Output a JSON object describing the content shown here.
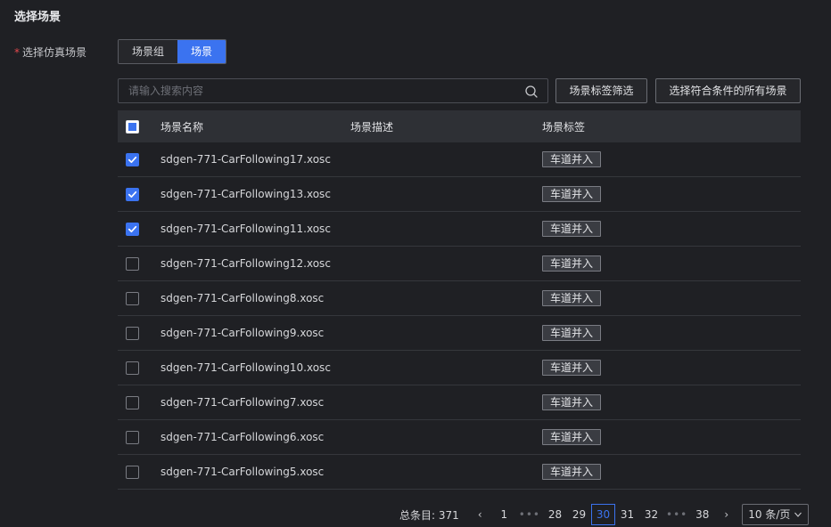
{
  "section": {
    "title": "选择场景"
  },
  "form": {
    "required_mark": "*",
    "label": "选择仿真场景",
    "segments": [
      {
        "label": "场景组",
        "active": false
      },
      {
        "label": "场景",
        "active": true
      }
    ]
  },
  "search": {
    "placeholder": "请输入搜索内容",
    "value": "",
    "icon": "search-icon"
  },
  "actions": {
    "tag_filter_label": "场景标签筛选",
    "select_all_label": "选择符合条件的所有场景"
  },
  "table": {
    "columns": [
      "场景名称",
      "场景描述",
      "场景标签"
    ],
    "header_checkbox": "indeterminate",
    "rows": [
      {
        "checked": true,
        "name": "sdgen-771-CarFollowing17.xosc",
        "desc": "",
        "tag": "车道并入"
      },
      {
        "checked": true,
        "name": "sdgen-771-CarFollowing13.xosc",
        "desc": "",
        "tag": "车道并入"
      },
      {
        "checked": true,
        "name": "sdgen-771-CarFollowing11.xosc",
        "desc": "",
        "tag": "车道并入"
      },
      {
        "checked": false,
        "name": "sdgen-771-CarFollowing12.xosc",
        "desc": "",
        "tag": "车道并入"
      },
      {
        "checked": false,
        "name": "sdgen-771-CarFollowing8.xosc",
        "desc": "",
        "tag": "车道并入"
      },
      {
        "checked": false,
        "name": "sdgen-771-CarFollowing9.xosc",
        "desc": "",
        "tag": "车道并入"
      },
      {
        "checked": false,
        "name": "sdgen-771-CarFollowing10.xosc",
        "desc": "",
        "tag": "车道并入"
      },
      {
        "checked": false,
        "name": "sdgen-771-CarFollowing7.xosc",
        "desc": "",
        "tag": "车道并入"
      },
      {
        "checked": false,
        "name": "sdgen-771-CarFollowing6.xosc",
        "desc": "",
        "tag": "车道并入"
      },
      {
        "checked": false,
        "name": "sdgen-771-CarFollowing5.xosc",
        "desc": "",
        "tag": "车道并入"
      }
    ]
  },
  "pagination": {
    "total_label": "总条目: 371",
    "prev": "‹",
    "next": "›",
    "pages": [
      "1",
      "•••",
      "28",
      "29",
      "30",
      "31",
      "32",
      "•••",
      "38"
    ],
    "current": "30",
    "page_size": "10 条/页"
  },
  "colors": {
    "accent": "#3b73f0",
    "background": "#1f2024",
    "header_bg": "#2e3035",
    "required": "#e5484d"
  }
}
